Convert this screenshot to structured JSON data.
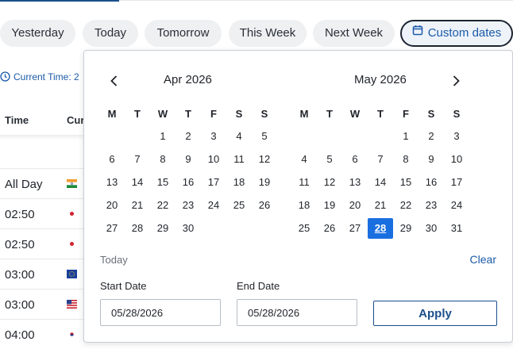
{
  "filters": {
    "yesterday": "Yesterday",
    "today": "Today",
    "tomorrow": "Tomorrow",
    "this_week": "This Week",
    "next_week": "Next Week",
    "custom": "Custom dates"
  },
  "current_time_label": "Current Time: 2",
  "table": {
    "headers": [
      "Time",
      "Cur"
    ],
    "rows": [
      {
        "time": "All Day",
        "flag": "india-flag"
      },
      {
        "time": "02:50",
        "flag": "japan-flag"
      },
      {
        "time": "02:50",
        "flag": "japan-flag"
      },
      {
        "time": "03:00",
        "flag": "eu-flag"
      },
      {
        "time": "03:00",
        "flag": "us-flag"
      },
      {
        "time": "04:00",
        "flag": "korea-flag"
      }
    ]
  },
  "datepicker": {
    "weekdays": [
      "M",
      "T",
      "W",
      "T",
      "F",
      "S",
      "S"
    ],
    "months": [
      {
        "title": "Apr 2026",
        "offset": 2,
        "weeks": [
          [
            "",
            "",
            "1",
            "2",
            "3",
            "4",
            "5"
          ],
          [
            "6",
            "7",
            "8",
            "9",
            "10",
            "11",
            "12"
          ],
          [
            "13",
            "14",
            "15",
            "16",
            "17",
            "18",
            "19"
          ],
          [
            "20",
            "21",
            "22",
            "23",
            "24",
            "25",
            "26"
          ],
          [
            "27",
            "28",
            "29",
            "30",
            "",
            "",
            ""
          ]
        ]
      },
      {
        "title": "May 2026",
        "weeks": [
          [
            "",
            "",
            "",
            "",
            "1",
            "2",
            "3"
          ],
          [
            "4",
            "5",
            "6",
            "7",
            "8",
            "9",
            "10"
          ],
          [
            "11",
            "12",
            "13",
            "14",
            "15",
            "16",
            "17"
          ],
          [
            "18",
            "19",
            "20",
            "21",
            "22",
            "23",
            "24"
          ],
          [
            "25",
            "26",
            "27",
            "28",
            "29",
            "30",
            "31"
          ]
        ]
      }
    ],
    "selected_day": "28",
    "today_label": "Today",
    "clear_label": "Clear",
    "start_label": "Start Date",
    "end_label": "End Date",
    "start_value": "05/28/2026",
    "end_value": "05/28/2026",
    "apply_label": "Apply"
  },
  "colors": {
    "accent": "#1a5aa8",
    "selected": "#1a6fe0",
    "pill_bg": "#eef0f2"
  }
}
